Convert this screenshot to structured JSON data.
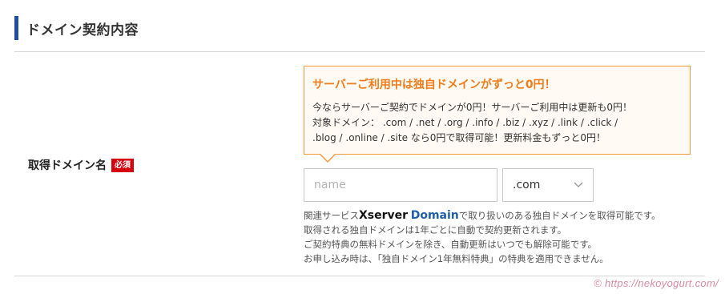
{
  "section": {
    "title": "ドメイン契約内容"
  },
  "field": {
    "label": "取得ドメイン名",
    "required_badge": "必須"
  },
  "promo": {
    "headline": "サーバーご利用中は独自ドメインがずっと0円！",
    "lines": [
      "今ならサーバーご契約でドメインが0円！サーバーご利用中は更新も0円！",
      "対象ドメイン： .com / .net / .org / .info / .biz / .xyz / .link / .click /",
      ".blog / .online / .site なら0円で取得可能！更新料金もずっと0円！"
    ]
  },
  "form": {
    "name_placeholder": "name",
    "name_value": "",
    "tld_selected": ".com"
  },
  "notes": {
    "line1_prefix": "関連サービス",
    "brand_x": "Xserver",
    "brand_domain": "Domain",
    "line1_suffix": "で取り扱いのある独自ドメインを取得可能です。",
    "line2": "取得される独自ドメインは1年ごとに自動で契約更新されます。",
    "line3": "ご契約特典の無料ドメインを除き、自動更新はいつでも解除可能です。",
    "line4": "お申し込み時は、「独自ドメイン1年無料特典」の特典を適用できません。"
  },
  "watermark": "© https://nekoyogurt.com/",
  "colors": {
    "heading_bar": "#1f4e9a",
    "promo_border": "#f29a3a",
    "promo_headline": "#f07c1a",
    "required_badge": "#d7000f",
    "brand_domain": "#1f5fa8"
  }
}
